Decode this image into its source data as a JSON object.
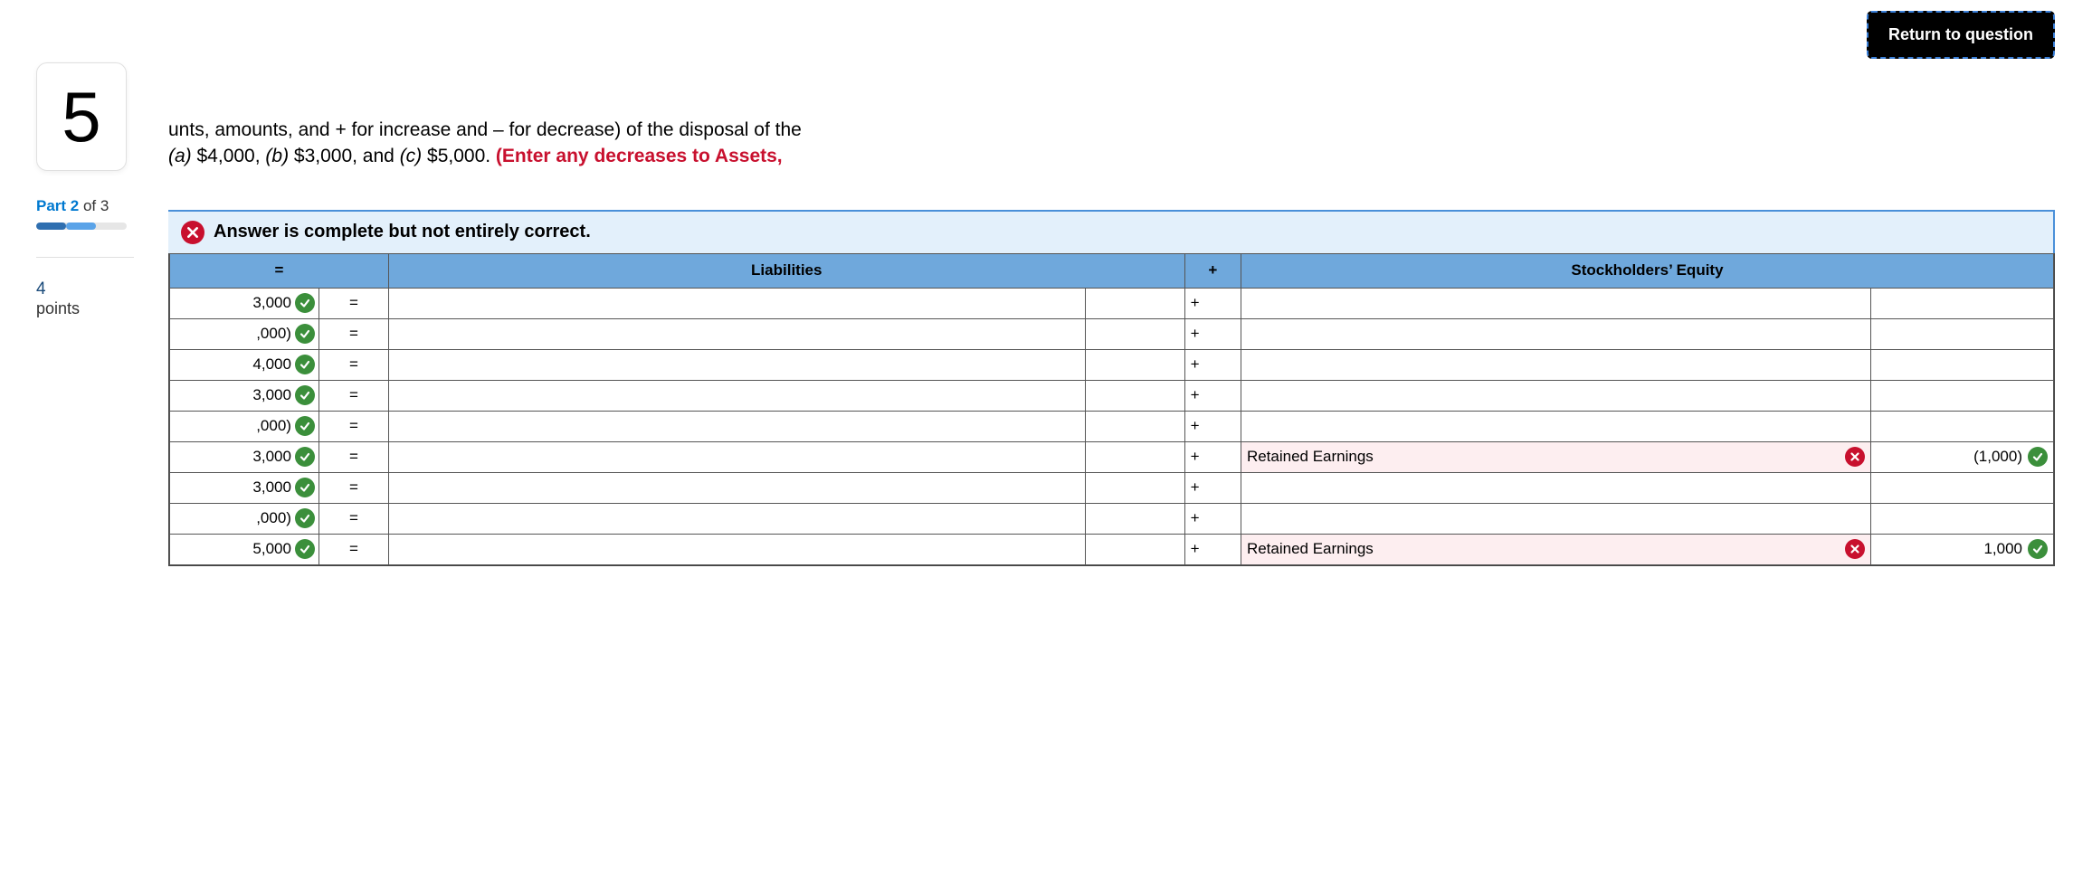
{
  "return_button": "Return to question",
  "question_number": "5",
  "part": {
    "label": "Part 2",
    "of": " of 3"
  },
  "points": {
    "value": "4",
    "label": "points"
  },
  "question": {
    "line1": "unts, amounts, and + for increase and – for decrease) of the disposal of the ",
    "italic_a": "(a)",
    "amount_a": " $4,000, ",
    "italic_b": "(b)",
    "amount_b": " $3,000, and ",
    "italic_c": "(c)",
    "amount_c": " $5,000. ",
    "red": "(Enter any decreases to Assets,"
  },
  "banner": "Answer is complete but not entirely correct.",
  "headers": {
    "eq": "=",
    "liabilities": "Liabilities",
    "plus": "+",
    "se": "Stockholders’ Equity"
  },
  "symbols": {
    "eq": "=",
    "plus": "+"
  },
  "rows": [
    {
      "val": "3,000",
      "val_ok": true,
      "se_label": "",
      "se_val": ""
    },
    {
      "val": ",000)",
      "val_ok": true,
      "se_label": "",
      "se_val": ""
    },
    {
      "val": "4,000",
      "val_ok": true,
      "se_label": "",
      "se_val": ""
    },
    {
      "val": "3,000",
      "val_ok": true,
      "se_label": "",
      "se_val": ""
    },
    {
      "val": ",000)",
      "val_ok": true,
      "se_label": "",
      "se_val": ""
    },
    {
      "val": "3,000",
      "val_ok": true,
      "se_label": "Retained Earnings",
      "se_label_ok": false,
      "se_val": "(1,000)",
      "se_val_ok": true
    },
    {
      "val": "3,000",
      "val_ok": true,
      "se_label": "",
      "se_val": ""
    },
    {
      "val": ",000)",
      "val_ok": true,
      "se_label": "",
      "se_val": ""
    },
    {
      "val": "5,000",
      "val_ok": true,
      "se_label": "Retained Earnings",
      "se_label_ok": false,
      "se_val": "1,000",
      "se_val_ok": true
    }
  ]
}
